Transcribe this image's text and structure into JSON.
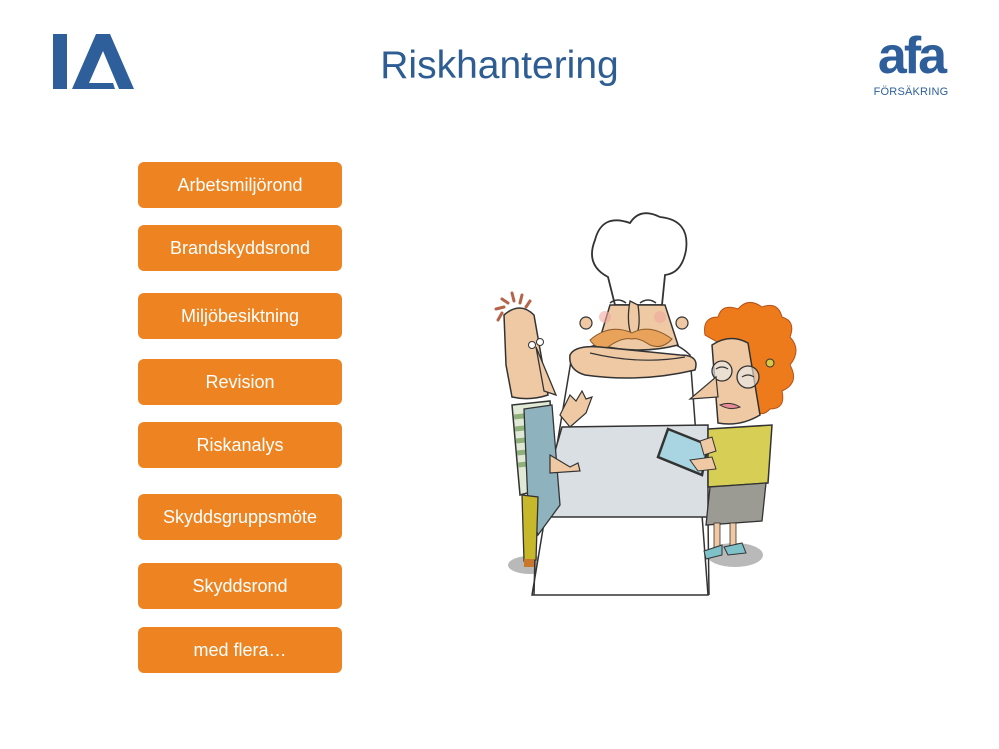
{
  "header": {
    "title": "Riskhantering",
    "left_logo": {
      "text": "IA",
      "icon": "ia-logo-icon"
    },
    "right_logo": {
      "word": "afa",
      "subtitle": "FÖRSÄKRING",
      "icon": "afa-forsakring-logo"
    }
  },
  "menu": {
    "items": [
      {
        "label": "Arbetsmiljörond"
      },
      {
        "label": "Brandskyddsrond"
      },
      {
        "label": "Miljöbesiktning"
      },
      {
        "label": "Revision"
      },
      {
        "label": "Riskanalys"
      },
      {
        "label": "Skyddsgruppsmöte"
      },
      {
        "label": "Skyddsrond"
      },
      {
        "label": "med flera…"
      }
    ]
  },
  "illustration": {
    "description": "Cartoon: chef with crossed arms behind a table, a man in apron and a red-haired woman with a tablet"
  },
  "colors": {
    "brand_blue": "#2e5f9b",
    "title_blue": "#2e5d93",
    "button_orange": "#ed8421",
    "button_text": "#ffffff"
  }
}
